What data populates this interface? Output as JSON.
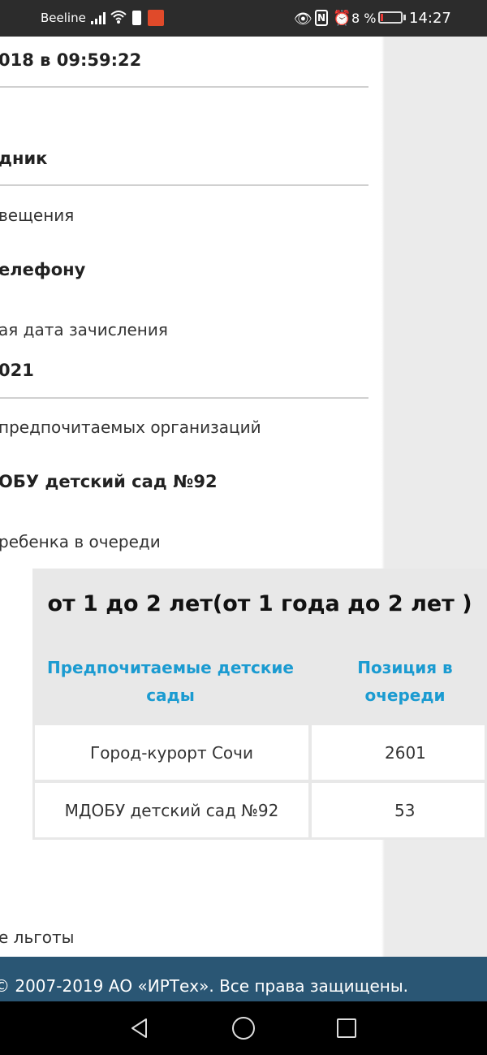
{
  "status_bar": {
    "carrier": "Beeline",
    "battery_percent": "8 %",
    "time": "14:27",
    "icons": [
      "signal-icon",
      "wifi-icon",
      "sim-icon",
      "app-notification-icon",
      "eye-icon",
      "nfc-icon",
      "alarm-icon",
      "battery-icon"
    ]
  },
  "content": {
    "datetime": "018 в 09:59:22",
    "source": "дник",
    "notify_label": "вещения",
    "notify_value": "елефону",
    "enroll_label": "ая дата зачисления",
    "enroll_value": "021",
    "orgs_label": "предпочитаемых организаций",
    "orgs_value": "ОБУ детский сад №92",
    "position_label": "ребенка в очереди",
    "benefits_label": "е льготы"
  },
  "queue": {
    "title": "от 1 до 2 лет(от 1 года до 2 лет )",
    "headers": [
      "Предпочитаемые детские сады",
      "Позиция в очереди"
    ],
    "header_lines": [
      [
        "Предпочитаемые детские",
        "сады"
      ],
      [
        "Позиция в",
        "очереди"
      ]
    ],
    "rows": [
      {
        "name": "Город-курорт Сочи",
        "position": "2601"
      },
      {
        "name": "МДОБУ детский сад №92",
        "position": "53"
      }
    ]
  },
  "footer": {
    "text": "© 2007-2019 АО «ИРТех». Все права защищены."
  },
  "nav": {
    "icons": [
      "back-icon",
      "home-icon",
      "recent-apps-icon"
    ]
  },
  "colors": {
    "accent": "#1b9bd1",
    "footer_bg": "#2a5674",
    "status_bar_bg": "#2c2c2c"
  }
}
